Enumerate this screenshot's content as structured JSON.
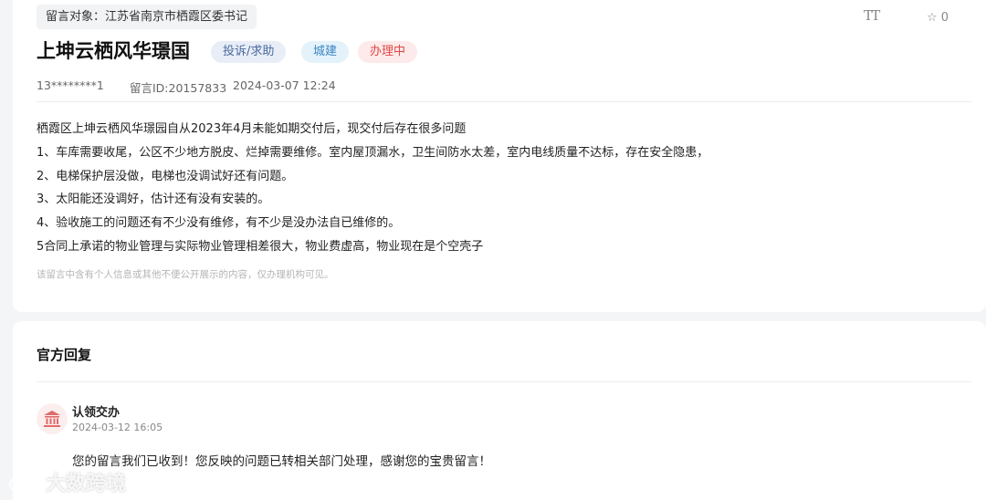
{
  "header": {
    "target_label": "留言对象：江苏省南京市栖霞区委书记",
    "font_size_icon": "text-size-icon",
    "font_size_glyph": "TT",
    "favorite_icon": "star-outline-icon",
    "favorite_count": "0"
  },
  "post": {
    "title": "上坤云栖风华璟国",
    "tags": {
      "type": "投诉/求助",
      "category": "城建",
      "status": "办理中"
    },
    "author": "13********1",
    "message_id": "留言ID:20157833",
    "datetime": "2024-03-07 12:24",
    "paragraphs": [
      "栖霞区上坤云栖风华璟园自从2023年4月未能如期交付后，现交付后存在很多问题",
      "1、车库需要收尾，公区不少地方脱皮、烂掉需要维修。室内屋顶漏水，卫生间防水太差，室内电线质量不达标，存在安全隐患，",
      "2、电梯保护层没做，电梯也没调试好还有问题。",
      "3、太阳能还没调好，估计还有没有安装的。",
      "4、验收施工的问题还有不少没有维修，有不少是没办法自已维修的。",
      "5合同上承诺的物业管理与实际物业管理相差很大，物业费虚高，物业现在是个空壳子"
    ],
    "privacy_note": "该留言中含有个人信息或其他不便公开展示的内容，仅办理机构可见。"
  },
  "reply": {
    "section_title": "官方回复",
    "icon": "government-building-icon",
    "name": "认领交办",
    "time": "2024-03-12 16:05",
    "content": "您的留言我们已收到！您反映的问题已转相关部门处理，感谢您的宝贵留言！"
  },
  "watermark": {
    "icon": "weibo-logo-icon",
    "text": "大数跨境"
  },
  "colors": {
    "tag_type_bg": "#e8edf7",
    "tag_type_text": "#4a6aa0",
    "tag_category_bg": "#e4f3fb",
    "tag_category_text": "#3b86c4",
    "tag_status_bg": "#fdeaea",
    "tag_status_text": "#e04848",
    "reply_icon_color": "#e06a6a"
  }
}
